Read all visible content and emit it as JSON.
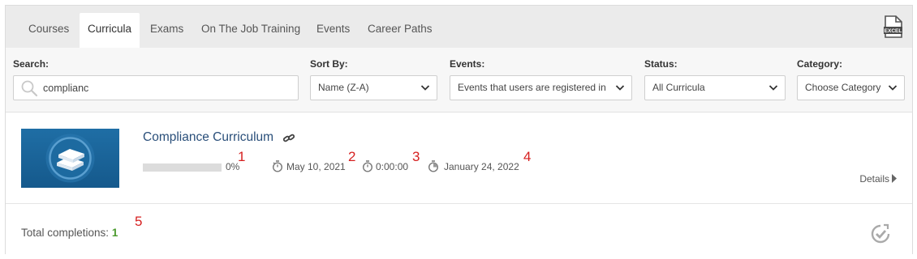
{
  "tabs": [
    {
      "label": "Courses"
    },
    {
      "label": "Curricula"
    },
    {
      "label": "Exams"
    },
    {
      "label": "On The Job Training"
    },
    {
      "label": "Events"
    },
    {
      "label": "Career Paths"
    }
  ],
  "active_tab": "Curricula",
  "export": {
    "icon": "excel-export-icon",
    "badge": "EXCEL"
  },
  "filters": {
    "search": {
      "label": "Search:",
      "value": "complianc",
      "icon": "search-icon"
    },
    "sort_by": {
      "label": "Sort By:",
      "selected": "Name (Z-A)"
    },
    "events": {
      "label": "Events:",
      "selected": "Events that users are registered in"
    },
    "status": {
      "label": "Status:",
      "selected": "All Curricula"
    },
    "category": {
      "label": "Category:",
      "selected": "Choose Category"
    }
  },
  "curriculum": {
    "title": "Compliance Curriculum",
    "progress_fraction": 0,
    "progress_text": "0%",
    "start_date": "May 10, 2021",
    "time_spent": "0:00:00",
    "expiry_date": "January 24, 2022",
    "details_label": "Details"
  },
  "annotations": {
    "a1": "1",
    "a2": "2",
    "a3": "3",
    "a4": "4",
    "a5": "5"
  },
  "footer": {
    "total_label": "Total completions:",
    "total_value": "1"
  },
  "colors": {
    "accent_link": "#2a4f7a",
    "completion_green": "#4b9b2e",
    "annotation_red": "#d62020",
    "thumb_blue": "#1a659b"
  }
}
